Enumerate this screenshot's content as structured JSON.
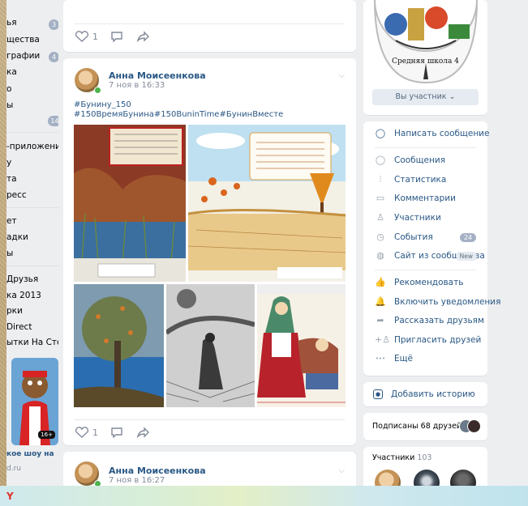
{
  "left_nav": {
    "items": [
      {
        "label": "ья",
        "badge": "3"
      },
      {
        "label": "щества",
        "badge": ""
      },
      {
        "label": "графии",
        "badge": "4"
      },
      {
        "label": "ка",
        "badge": ""
      },
      {
        "label": "о",
        "badge": ""
      },
      {
        "label": "ы",
        "badge": ""
      },
      {
        "label": "",
        "badge": "14"
      },
      {
        "label": "-приложения",
        "badge": ""
      },
      {
        "label": "у",
        "badge": ""
      },
      {
        "label": "та",
        "badge": ""
      },
      {
        "label": "ресс",
        "badge": ""
      },
      {
        "label": "ет",
        "badge": ""
      },
      {
        "label": "адки",
        "badge": ""
      },
      {
        "label": "ы",
        "badge": ""
      },
      {
        "label": "Друзья",
        "badge": ""
      },
      {
        "label": "ка 2013",
        "badge": ""
      },
      {
        "label": "рки",
        "badge": ""
      },
      {
        "label": "Direct",
        "badge": ""
      },
      {
        "label": "ытки На Стену",
        "badge": ""
      }
    ],
    "promo": {
      "age_tag": "16+",
      "title": "кое шоу на",
      "source": "d.ru"
    }
  },
  "feed": {
    "post_top": {
      "likes": "1"
    },
    "post_main": {
      "author": "Анна Моисеенкова",
      "date": "7 ноя в 16:33",
      "hashtag_line1": "#Бунину_150",
      "hashtag_line2": "#150ВремяБунина#150BuninTime#БунинВместе",
      "likes": "1"
    },
    "post_next": {
      "author": "Анна Моисеенкова",
      "date": "7 ноя в 16:27"
    }
  },
  "right": {
    "group_logo_text": "Средняя школа 4",
    "member_button": "Вы участник ⌄",
    "write_message": "Написать сообщение",
    "menu": [
      {
        "icon": "chat-icon",
        "glyph": "◯",
        "label": "Сообщения",
        "badge": ""
      },
      {
        "icon": "stats-icon",
        "glyph": "⫶",
        "label": "Статистика",
        "badge": ""
      },
      {
        "icon": "comment-icon",
        "glyph": "▭",
        "label": "Комментарии",
        "badge": ""
      },
      {
        "icon": "user-icon",
        "glyph": "♙",
        "label": "Участники",
        "badge": ""
      },
      {
        "icon": "events-icon",
        "glyph": "◷",
        "label": "События",
        "badge": "24"
      },
      {
        "icon": "globe-icon",
        "glyph": "◍",
        "label": "Сайт из сообщества",
        "badge": "New"
      }
    ],
    "menu2": [
      {
        "icon": "thumb-up-icon",
        "glyph": "👍",
        "label": "Рекомендовать"
      },
      {
        "icon": "bell-icon",
        "glyph": "🔔",
        "label": "Включить уведомления"
      },
      {
        "icon": "share-icon",
        "glyph": "➦",
        "label": "Рассказать друзьям"
      },
      {
        "icon": "add-user-icon",
        "glyph": "+♙",
        "label": "Пригласить друзей"
      },
      {
        "icon": "more-icon",
        "glyph": "•••",
        "label": "Ещё"
      }
    ],
    "add_story": "Добавить историю",
    "friends_subscribed": "Подписаны 68 друзей",
    "members_label": "Участники",
    "members_count": "103"
  },
  "colors": {
    "link": "#2a5885",
    "muted": "#828a99",
    "badge": "#a4b0c3",
    "bg": "#edeef0"
  }
}
